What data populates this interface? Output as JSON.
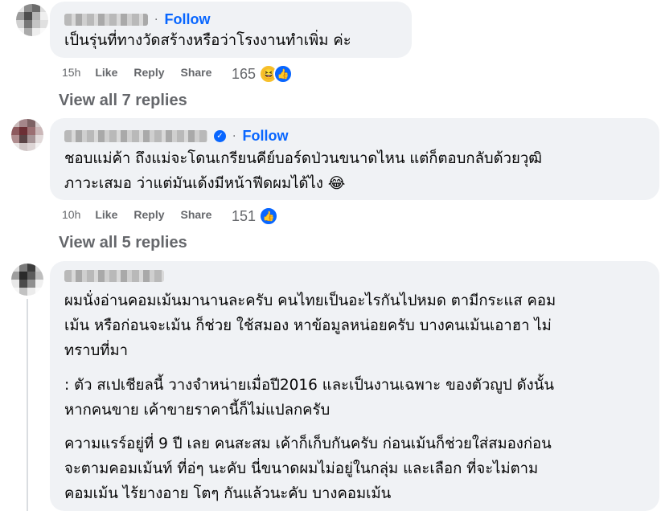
{
  "comments": [
    {
      "follow": "Follow",
      "lines": [
        "เป็นรุ่นที่ทางวัดสร้างหรือว่าโรงงานทำเพิ่ม ค่ะ"
      ],
      "time": "15h",
      "like": "Like",
      "reply": "Reply",
      "share": "Share",
      "reaction_count": "165",
      "reaction_icons": [
        "haha-icon",
        "like-icon"
      ],
      "view_replies": "View all 7 replies"
    },
    {
      "follow": "Follow",
      "verified": true,
      "lines": [
        "ชอบแม่ค้า ถึงแม่จะโดนเกรียนคีย์บอร์ดป่วนขนาดไหน แต่ก็ตอบกลับด้วยวุฒิ",
        "ภาวะเสมอ ว่าแต่มันเด้งมีหน้าฟีดผมได้ไง 😂"
      ],
      "time": "10h",
      "like": "Like",
      "reply": "Reply",
      "share": "Share",
      "reaction_count": "151",
      "reaction_icons": [
        "like-icon"
      ],
      "view_replies": "View all 5 replies"
    },
    {
      "paragraphs": [
        [
          "ผมนั่งอ่านคอมเม้นมานานละครับ คนไทยเป็นอะไรกันไปหมด ตามีกระแส คอม",
          "เม้น หรือก่อนจะเม้น ก็ช่วย ใช้สมอง หาข้อมูลหน่อยครับ บางคนเม้นเอาฮา ไม่",
          "ทราบที่มา"
        ],
        [
          ": ตัว สเปเชียลนี้ วางจำหน่ายเมื่อปี2016 และเป็นงานเฉพาะ ของตัวญูป ดังนั้น",
          "หากคนขาย เค้าขายราคานี้ก็ไม่แปลกครับ"
        ],
        [
          "ความแรร์อยู่ที่ 9 ปี เลย คนสะสม เค้าก็เก็บกันครับ ก่อนเม้นก็ช่วยใส่สมองก่อน",
          "จะตามคอมเม้นท์ ที่อ่ๆ นะคับ นี่ขนาดผมไม่อยู่ในกลุ่ม และเลือก ที่จะไม่ตาม",
          "คอมเม้น ไร้ยางอาย โตๆ กันแล้วนะคับ บางคอมเม้น"
        ]
      ]
    }
  ],
  "colors": {
    "bubble": "#f0f2f5",
    "link": "#0866ff",
    "meta": "#65676b"
  }
}
